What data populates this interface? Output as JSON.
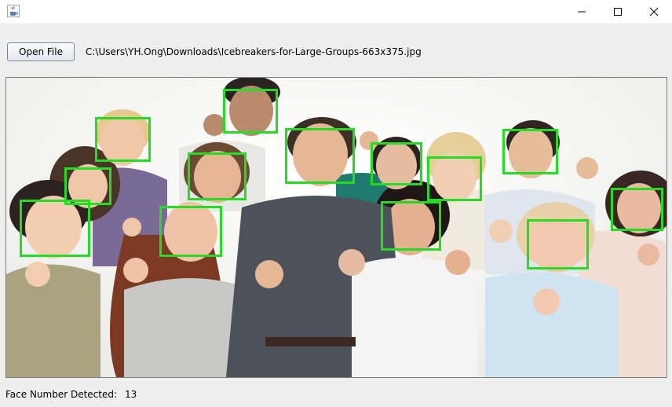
{
  "window": {
    "icon": "java-cup-icon",
    "controls": [
      "minimize-icon",
      "maximize-icon",
      "close-icon"
    ]
  },
  "toolbar": {
    "open_label": "Open File",
    "file_path": "C:\\Users\\YH.Ong\\Downloads\\Icebreakers-for-Large-Groups-663x375.jpg"
  },
  "image": {
    "subject": "group photo",
    "detection_box_color": "#22dd22"
  },
  "status": {
    "label": "Face Number Detected:",
    "count": "13"
  }
}
